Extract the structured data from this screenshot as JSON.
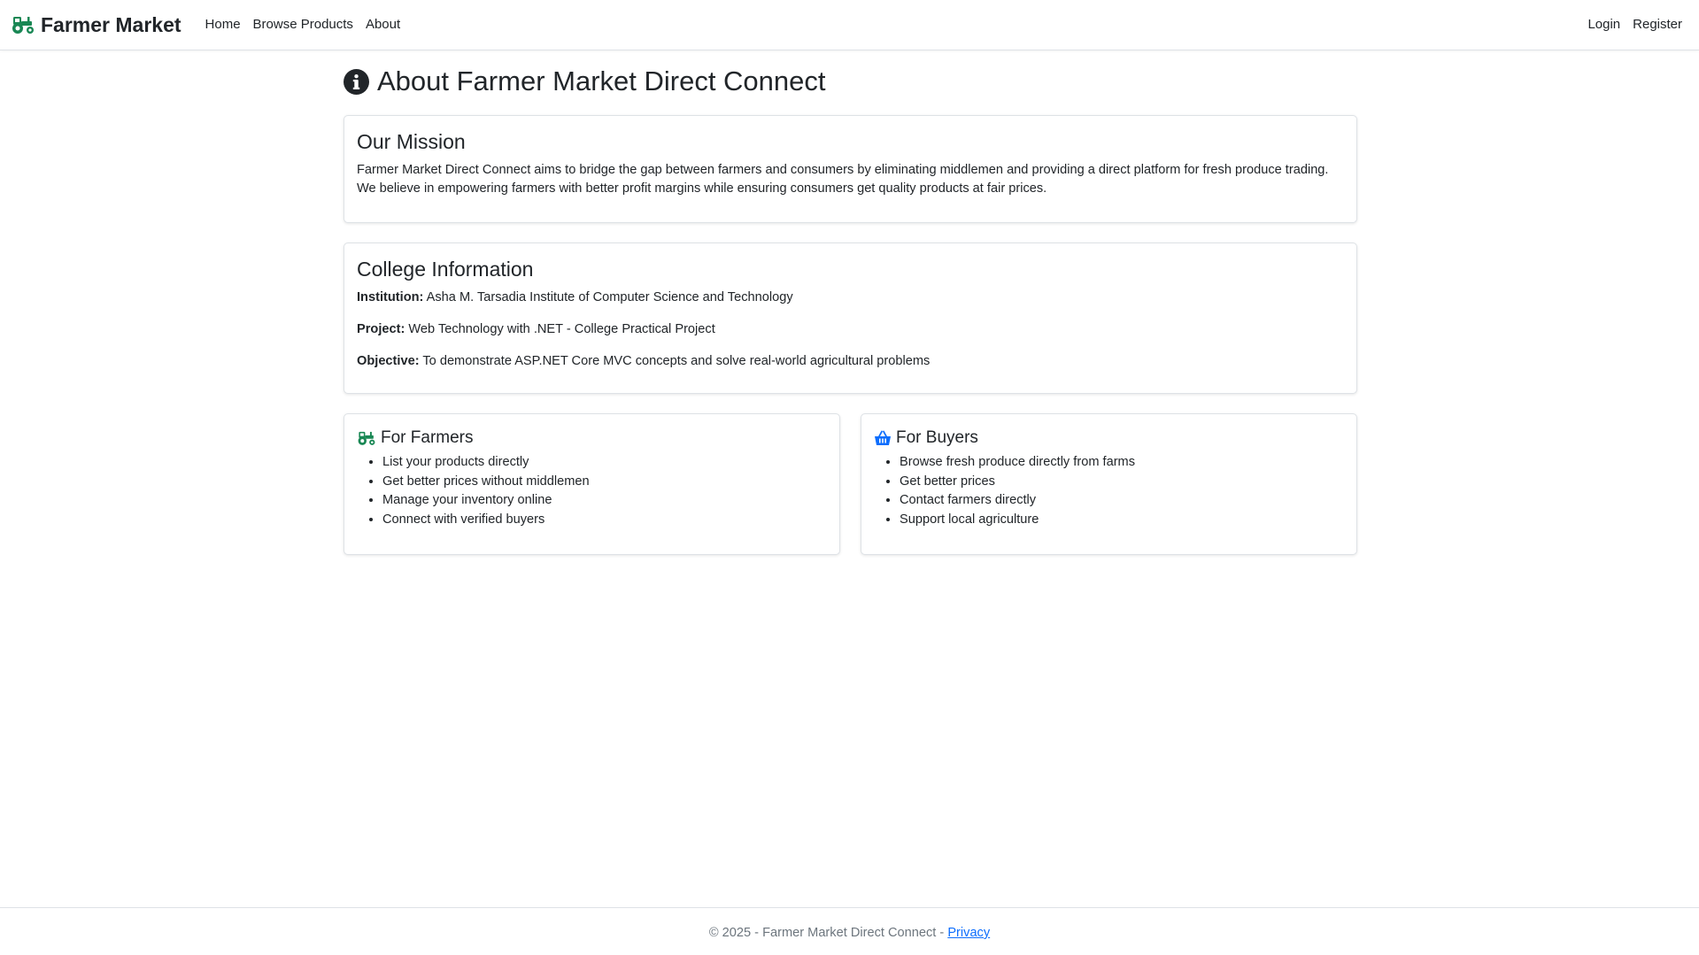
{
  "nav": {
    "brand": "Farmer Market",
    "links": [
      "Home",
      "Browse Products",
      "About"
    ],
    "login": "Login",
    "register": "Register"
  },
  "page": {
    "title": "About Farmer Market Direct Connect",
    "title_icon": "info-circle-icon"
  },
  "mission": {
    "heading": "Our Mission",
    "text": "Farmer Market Direct Connect aims to bridge the gap between farmers and consumers by eliminating middlemen and providing a direct platform for fresh produce trading. We believe in empowering farmers with better profit margins while ensuring consumers get quality products at fair prices."
  },
  "college": {
    "heading": "College Information",
    "institution_label": "Institution:",
    "institution": "Asha M. Tarsadia Institute of Computer Science and Technology",
    "project_label": "Project:",
    "project": "Web Technology with .NET - College Practical Project",
    "objective_label": "Objective:",
    "objective": "To demonstrate ASP.NET Core MVC concepts and solve real-world agricultural problems"
  },
  "farmers": {
    "heading": "For Farmers",
    "icon": "tractor-icon",
    "items": [
      "List your products directly",
      "Get better prices without middlemen",
      "Manage your inventory online",
      "Connect with verified buyers"
    ]
  },
  "buyers": {
    "heading": "For Buyers",
    "icon": "basket-icon",
    "items": [
      "Browse fresh produce directly from farms",
      "Get better prices",
      "Contact farmers directly",
      "Support local agriculture"
    ]
  },
  "footer": {
    "text": "© 2025 - Farmer Market Direct Connect - ",
    "privacy": "Privacy"
  },
  "colors": {
    "brand_green": "#198754",
    "link_blue": "#0d6efd",
    "text": "#212529"
  }
}
